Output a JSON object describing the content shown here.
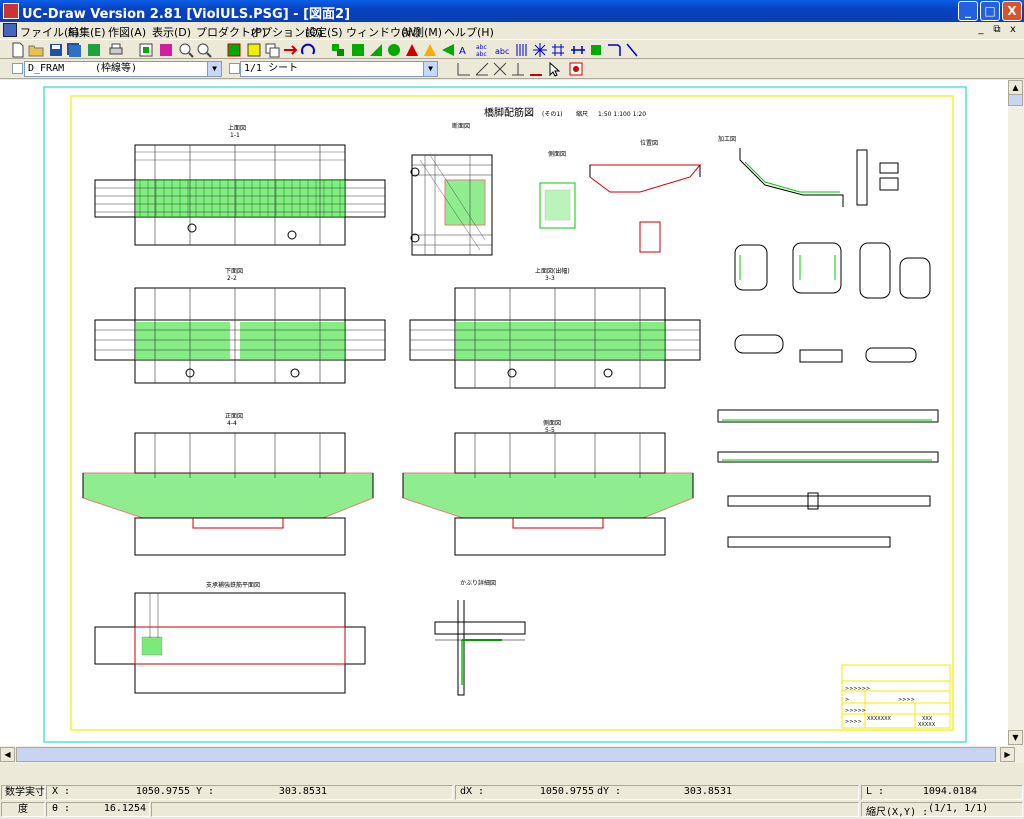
{
  "window": {
    "title": "UC-Draw Version 2.81 [ViolULS.PSG] - [図面2]",
    "minimize_glyph": "_",
    "maximize_glyph": "□",
    "close_glyph": "X"
  },
  "menu": {
    "items": [
      "ファイル(F)",
      "編集(E)",
      "作図(A)",
      "表示(D)",
      "プロダクト(P)",
      "オプション(O)",
      "設定(S)",
      "ウィンドウ(W)",
      "計測(M)",
      "ヘルプ(H)"
    ],
    "mdi_min": "_",
    "mdi_restore": "⧉",
    "mdi_close": "x"
  },
  "toolbar2": {
    "layer_value": "D_FRAM",
    "layer_desc": "(枠線等)",
    "sheet_value": "1/1 シート"
  },
  "drawing": {
    "sheet_title": "橋脚配筋図",
    "sheet_subtitle": "(その1)",
    "scale_label": "縮尺",
    "scale_values": "1:50   1:100   1:20",
    "view1_title": "上面図",
    "view1_sub": "1-1",
    "view2_title": "下面図",
    "view2_sub": "2-2",
    "view3_title": "上面図(出幅)",
    "view3_sub": "3-3",
    "view4_title": "正面図",
    "view4_sub": "4-4",
    "view5_title": "側面図",
    "view5_sub": "5-5",
    "view6_title": "支承補強鉄筋平面図",
    "view7_title": "かぶり詳細図",
    "section_title": "断面図",
    "side_title": "側面図",
    "detail_title": "位置図",
    "bend_title": "加工図",
    "titleblock": {
      "row1": ">>>>>>",
      "row2a": ">",
      "row2b": ">>>>",
      "row3": ">>>>>",
      "row4a": ">>>>",
      "row4b": "XXXXXXX",
      "row4c": "XXX",
      "row4d": "XXXXX"
    }
  },
  "status": {
    "mode": "数学実寸",
    "x_label": "X :",
    "x_value": "1050.9755",
    "y_label": "Y :",
    "y_value": "303.8531",
    "dx_label": "dX :",
    "dx_value": "1050.9755",
    "dy_label": "dY :",
    "dy_value": "303.8531",
    "l_label": "L :",
    "l_value": "1094.0184",
    "angle_unit": "度",
    "theta_label": "θ :",
    "theta_value": "16.1254",
    "scale_label": "縮尺(X,Y) :",
    "scale_value": "(1/1, 1/1)"
  }
}
